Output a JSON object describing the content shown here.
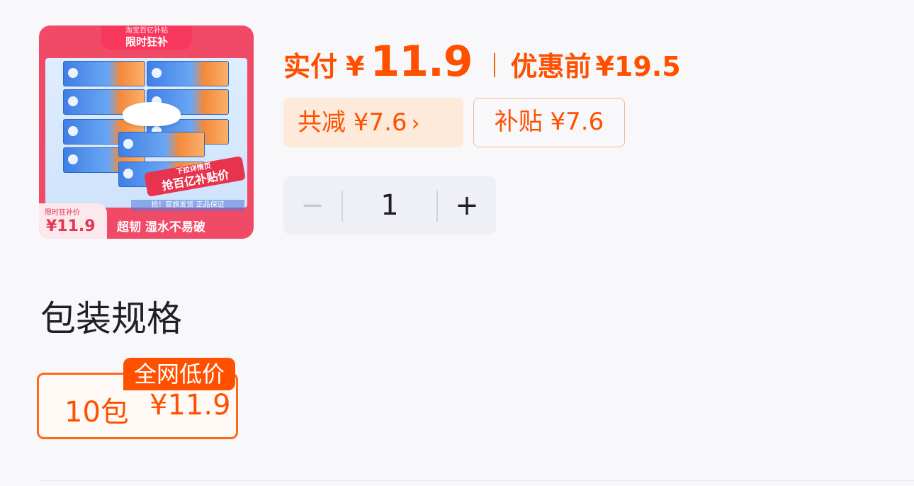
{
  "product_image": {
    "top_banner_small": "淘宝百亿补贴",
    "top_banner_main": "限时狂补",
    "promo_small": "下拉详情页",
    "promo_main": "抢百亿补贴价",
    "notice": "抢！官旗发货 正品保证",
    "price_label": "限时狂补价",
    "price": "¥11.9",
    "slogan": "超韧 湿水不易破"
  },
  "price": {
    "pay_label": "实付",
    "pay_yen": "¥",
    "pay_amount": "11.9",
    "before_label": "优惠前",
    "before_price": "¥19.5"
  },
  "tags": {
    "total_discount": "共减 ¥7.6",
    "chevron": "›",
    "subsidy": "补贴 ¥7.6"
  },
  "quantity": {
    "minus": "−",
    "value": "1",
    "plus": "+"
  },
  "section": {
    "title": "包装规格"
  },
  "option": {
    "label": "10包",
    "price": "¥11.9",
    "badge": "全网低价"
  },
  "colors": {
    "accent": "#ff5000",
    "tag_bg": "#fdeadb",
    "stepper_bg": "#eef0f5"
  }
}
